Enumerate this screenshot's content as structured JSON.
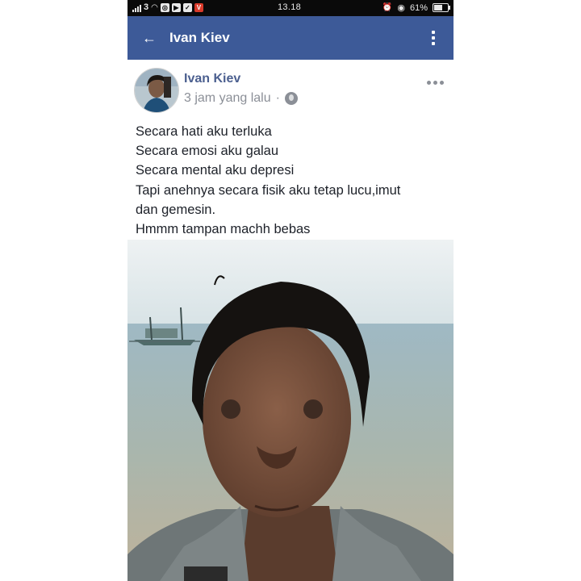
{
  "status_bar": {
    "carrier_badge": "3",
    "time": "13.18",
    "battery_percent": "61%",
    "battery_level": 0.61
  },
  "app_bar": {
    "title": "Ivan Kiev"
  },
  "post": {
    "author": "Ivan Kiev",
    "timestamp": "3 jam yang lalu",
    "separator": "·",
    "lines": [
      "Secara hati aku terluka",
      "Secara emosi aku galau",
      "Secara mental aku depresi",
      "Tapi anehnya secara fisik aku tetap lucu,imut",
      "dan gemesin.",
      "Hmmm tampan machh bebas"
    ]
  },
  "colors": {
    "app_bar": "#3d5a98",
    "author_name": "#4b5f8f",
    "meta_text": "#8b8f97",
    "body_text": "#1d2129"
  },
  "icons": {
    "back": "arrow-left-icon",
    "overflow": "vertical-dots-icon",
    "privacy": "globe-icon",
    "post_menu": "horizontal-dots-icon"
  }
}
